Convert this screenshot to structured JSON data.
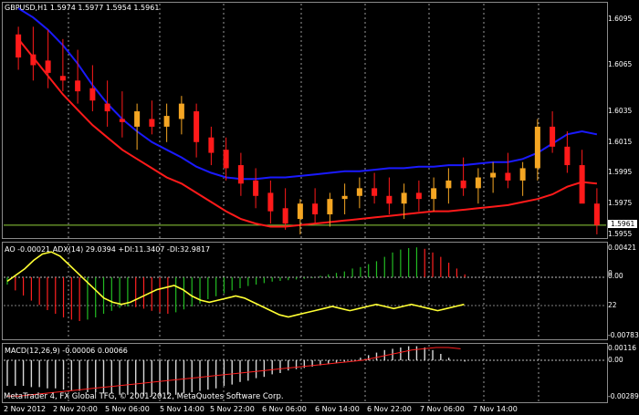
{
  "chart_data": [
    {
      "type": "line",
      "name": "main",
      "title": "GBPUSD,H1",
      "ohlc_text": "1.5974 1.5977 1.5954 1.5961",
      "current_price": "1.5961",
      "ylim": [
        1.5952,
        1.6105
      ],
      "yticks": [
        "1.6095",
        "1.6065",
        "1.6035",
        "1.6015",
        "1.5995",
        "1.5975",
        "1.5955"
      ],
      "ytick_values": [
        1.6095,
        1.6065,
        1.6035,
        1.6015,
        1.5995,
        1.5975,
        1.5955
      ],
      "hline": 1.5961,
      "candles": [
        [
          1.6085,
          1.609,
          1.6062,
          1.607
        ],
        [
          1.6072,
          1.609,
          1.6055,
          1.6065
        ],
        [
          1.6068,
          1.6088,
          1.605,
          1.606
        ],
        [
          1.6058,
          1.6082,
          1.6048,
          1.6055
        ],
        [
          1.6055,
          1.6075,
          1.604,
          1.6048
        ],
        [
          1.605,
          1.6065,
          1.6035,
          1.6042
        ],
        [
          1.604,
          1.6055,
          1.6025,
          1.6035
        ],
        [
          1.603,
          1.6048,
          1.6018,
          1.6028
        ],
        [
          1.6025,
          1.604,
          1.601,
          1.6035
        ],
        [
          1.603,
          1.6042,
          1.602,
          1.6025
        ],
        [
          1.6025,
          1.604,
          1.6015,
          1.6032
        ],
        [
          1.603,
          1.6045,
          1.602,
          1.604
        ],
        [
          1.6035,
          1.604,
          1.6005,
          1.6015
        ],
        [
          1.6018,
          1.6025,
          1.6,
          1.6008
        ],
        [
          1.601,
          1.6018,
          1.599,
          1.5998
        ],
        [
          1.6,
          1.6008,
          1.598,
          1.5988
        ],
        [
          1.599,
          1.5998,
          1.5972,
          1.598
        ],
        [
          1.5982,
          1.599,
          1.5962,
          1.597
        ],
        [
          1.5972,
          1.5985,
          1.5958,
          1.5962
        ],
        [
          1.5965,
          1.5978,
          1.5955,
          1.5975
        ],
        [
          1.5975,
          1.5985,
          1.5962,
          1.5968
        ],
        [
          1.5968,
          1.5982,
          1.596,
          1.5978
        ],
        [
          1.5978,
          1.5988,
          1.5968,
          1.598
        ],
        [
          1.598,
          1.5992,
          1.5972,
          1.5985
        ],
        [
          1.5985,
          1.5995,
          1.5975,
          1.598
        ],
        [
          1.598,
          1.5992,
          1.5968,
          1.5975
        ],
        [
          1.5975,
          1.5988,
          1.5965,
          1.5982
        ],
        [
          1.5982,
          1.599,
          1.597,
          1.5978
        ],
        [
          1.5978,
          1.5992,
          1.597,
          1.5985
        ],
        [
          1.5985,
          1.5998,
          1.5975,
          1.599
        ],
        [
          1.599,
          1.6005,
          1.598,
          1.5985
        ],
        [
          1.5985,
          1.5998,
          1.5975,
          1.5992
        ],
        [
          1.5992,
          1.6002,
          1.5982,
          1.5995
        ],
        [
          1.5995,
          1.6008,
          1.5985,
          1.599
        ],
        [
          1.599,
          1.6002,
          1.598,
          1.5998
        ],
        [
          1.5998,
          1.603,
          1.599,
          1.6025
        ],
        [
          1.6025,
          1.6035,
          1.6008,
          1.6012
        ],
        [
          1.6012,
          1.6022,
          1.5995,
          1.6
        ],
        [
          1.6,
          1.601,
          1.598,
          1.5975
        ],
        [
          1.5975,
          1.5985,
          1.5955,
          1.5961
        ]
      ],
      "series": [
        {
          "color": "#1a1aff",
          "values": [
            1.6102,
            1.6096,
            1.6088,
            1.6078,
            1.6066,
            1.6052,
            1.604,
            1.603,
            1.6022,
            1.6015,
            1.601,
            1.6005,
            1.5999,
            1.5995,
            1.5992,
            1.5991,
            1.5991,
            1.5992,
            1.5992,
            1.5993,
            1.5994,
            1.5995,
            1.5996,
            1.5996,
            1.5997,
            1.5998,
            1.5998,
            1.5999,
            1.5999,
            1.6,
            1.6,
            1.6001,
            1.6002,
            1.6002,
            1.6004,
            1.6008,
            1.6014,
            1.602,
            1.6022,
            1.602
          ]
        },
        {
          "color": "#ff1a1a",
          "values": [
            1.6082,
            1.607,
            1.6058,
            1.6046,
            1.6036,
            1.6026,
            1.6018,
            1.601,
            1.6004,
            1.5998,
            1.5992,
            1.5988,
            1.5982,
            1.5976,
            1.597,
            1.5965,
            1.5962,
            1.596,
            1.596,
            1.5961,
            1.5962,
            1.5963,
            1.5964,
            1.5965,
            1.5966,
            1.5967,
            1.5968,
            1.5969,
            1.597,
            1.597,
            1.5971,
            1.5972,
            1.5973,
            1.5974,
            1.5976,
            1.5978,
            1.5981,
            1.5986,
            1.5989,
            1.5988
          ]
        }
      ]
    },
    {
      "type": "bar",
      "name": "ao",
      "title": "AO -0.00021",
      "legend_extra": "ADX(14) 29.0394 +DI:11.3407 -DI:32.9817",
      "yticks": [
        "0.00421",
        "0.00",
        "0",
        "22",
        "-0.00783"
      ],
      "ao_values": [
        -0.001,
        -0.0018,
        -0.0025,
        -0.0032,
        -0.0038,
        -0.0045,
        -0.005,
        -0.0055,
        -0.0058,
        -0.006,
        -0.0058,
        -0.0055,
        -0.005,
        -0.0046,
        -0.0042,
        -0.004,
        -0.0041,
        -0.0043,
        -0.0046,
        -0.0048,
        -0.005,
        -0.0048,
        -0.0044,
        -0.004,
        -0.0036,
        -0.003,
        -0.0026,
        -0.0022,
        -0.0018,
        -0.0015,
        -0.0012,
        -0.001,
        -0.0008,
        -0.0006,
        -0.0005,
        -0.0004,
        -0.0003,
        -0.0002,
        -0.0001,
        0.0002,
        0.0004,
        0.0006,
        0.0008,
        0.0012,
        0.0014,
        0.0018,
        0.0022,
        0.0028,
        0.0034,
        0.0038,
        0.004,
        0.0041,
        0.0039,
        0.0034,
        0.0028,
        0.002,
        0.0012,
        0.0004
      ],
      "adx_values": [
        22,
        25,
        28,
        32,
        35,
        36,
        34,
        30,
        26,
        22,
        18,
        14,
        12,
        11,
        12,
        14,
        16,
        18,
        19,
        20,
        18,
        15,
        13,
        12,
        13,
        14,
        15,
        14,
        12,
        10,
        8,
        6,
        5,
        6,
        7,
        8,
        9,
        10,
        9,
        8,
        9,
        10,
        11,
        10,
        9,
        10,
        11,
        10,
        9,
        8,
        9,
        10,
        11
      ]
    },
    {
      "type": "bar",
      "name": "macd",
      "title": "MACD(12,26,9) -0.00006 0.00066",
      "yticks": [
        "0.00116",
        "0.00",
        "-0.00289"
      ],
      "macd_values": [
        -0.002,
        -0.002,
        -0.002,
        -0.0021,
        -0.0021,
        -0.0022,
        -0.0022,
        -0.0023,
        -0.0024,
        -0.0024,
        -0.0025,
        -0.0025,
        -0.0026,
        -0.0026,
        -0.0027,
        -0.0027,
        -0.0027,
        -0.0028,
        -0.0028,
        -0.0028,
        -0.0027,
        -0.0027,
        -0.0026,
        -0.0025,
        -0.0024,
        -0.0023,
        -0.0022,
        -0.002,
        -0.0019,
        -0.0017,
        -0.0016,
        -0.0014,
        -0.0013,
        -0.0011,
        -0.001,
        -0.0008,
        -0.0007,
        -0.0006,
        -0.0005,
        -0.0004,
        -0.0003,
        -0.0002,
        -0.0001,
        0.0,
        0.0002,
        0.0004,
        0.0006,
        0.0008,
        0.0009,
        0.001,
        0.0011,
        0.0011,
        0.001,
        0.0008,
        0.0005,
        0.0002,
        0.0,
        -0.0001
      ],
      "signal_values": [
        -0.0028,
        -0.0028,
        -0.0027,
        -0.0026,
        -0.0025,
        -0.0024,
        -0.0023,
        -0.0022,
        -0.0021,
        -0.002,
        -0.0019,
        -0.0018,
        -0.0017,
        -0.0016,
        -0.0015,
        -0.0014,
        -0.0013,
        -0.0012,
        -0.0011,
        -0.001,
        -0.0009,
        -0.0008,
        -0.0007,
        -0.0006,
        -0.0005,
        -0.0004,
        -0.0003,
        -0.0002,
        -0.0001,
        0.0,
        0.0002,
        0.0004,
        0.0006,
        0.0008,
        0.0009,
        0.001,
        0.001,
        0.0009
      ]
    }
  ],
  "x_labels": [
    "2 Nov 2012",
    "2 Nov 20:00",
    "5 Nov 06:00",
    "5 Nov 14:00",
    "5 Nov 22:00",
    "6 Nov 06:00",
    "6 Nov 14:00",
    "6 Nov 22:00",
    "7 Nov 06:00",
    "7 Nov 14:00"
  ],
  "footer": "MetaTrader 4, FX Global TFG, © 2001-2012, MetaQuotes Software Corp.",
  "colors": {
    "bull": "#22bb22",
    "bear": "#ff2020",
    "up_candle": "#f5a623",
    "down_candle": "#ff1a1a",
    "adx": "#ffff33",
    "grid": "#ffffff"
  }
}
